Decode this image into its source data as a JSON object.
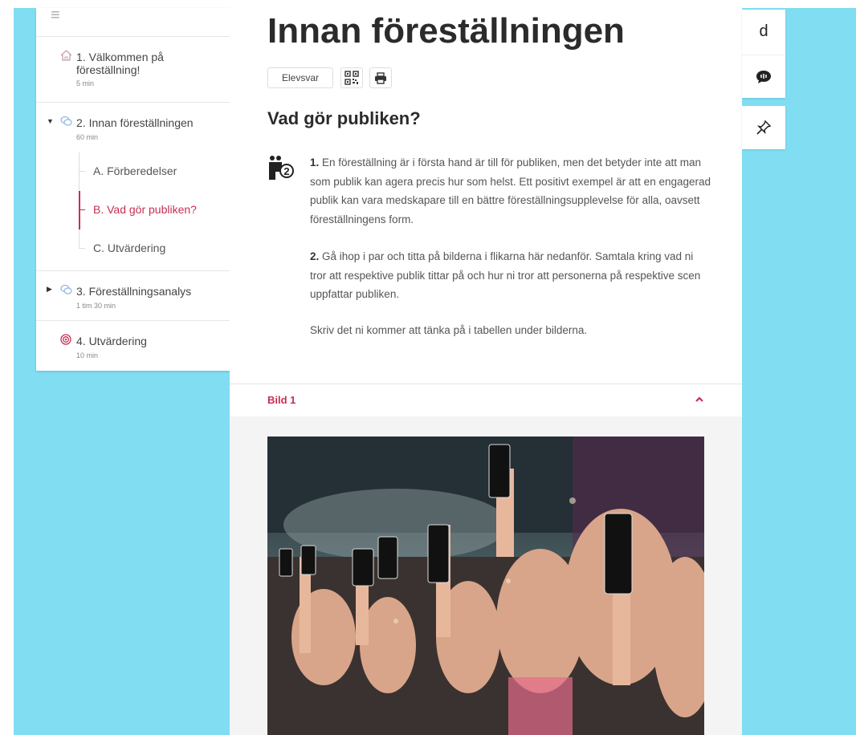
{
  "sidebar": {
    "menu_icon": "hamburger-icon",
    "sections": [
      {
        "title_line1": "1. Välkommen på",
        "title_line2": "föreställning!",
        "duration": "5 min",
        "icon": "home-icon"
      },
      {
        "title": "2. Innan föreställningen",
        "duration": "60 min",
        "icon": "chat-icon",
        "expanded": true
      },
      {
        "title": "3. Föreställningsanalys",
        "duration": "1 tim 30 min",
        "icon": "chat-icon",
        "expanded": false
      },
      {
        "title": "4. Utvärdering",
        "duration": "10 min",
        "icon": "target-icon"
      }
    ],
    "subitems": [
      {
        "label": "A. Förberedelser",
        "active": false
      },
      {
        "label": "B. Vad gör publiken?",
        "active": true
      },
      {
        "label": "C. Utvärdering",
        "active": false
      }
    ]
  },
  "main": {
    "title": "Innan föreställningen",
    "elevsvar_label": "Elevsvar",
    "heading": "Vad gör publiken?",
    "paragraphs": [
      {
        "num": "1.",
        "text": " En föreställning är i första hand är till för publiken, men det betyder inte att man som publik kan agera precis hur som helst. Ett positivt exempel är att en engagerad publik kan vara medskapare till en bättre föreställningsupplevelse för alla, oavsett föreställningens form."
      },
      {
        "num": "2.",
        "text": " Gå ihop i par och titta på bilderna i flikarna här nedanför. Samtala kring vad ni tror att respektive publik tittar på och hur ni tror att personerna på respektive scen uppfattar publiken."
      },
      {
        "num": "",
        "text": "Skriv det ni kommer att tänka på i tabellen under bilderna."
      }
    ],
    "accordion_label": "Bild 1",
    "accent_color": "#c62f52"
  },
  "tools": {
    "top_letter": "d"
  },
  "colors": {
    "background": "#80ddf2",
    "accent": "#c62f52"
  }
}
